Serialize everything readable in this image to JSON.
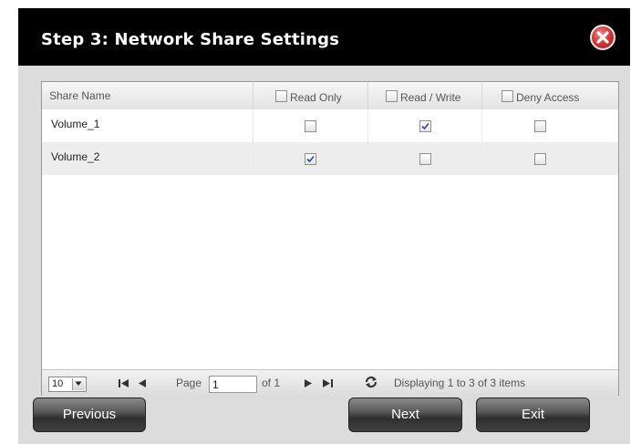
{
  "dialog": {
    "title": "Step 3: Network Share Settings",
    "close_icon": "close-icon"
  },
  "table": {
    "columns": [
      {
        "label": "Share Name"
      },
      {
        "label": "Read Only",
        "checked": false
      },
      {
        "label": "Read / Write",
        "checked": false
      },
      {
        "label": "Deny Access",
        "checked": false
      }
    ],
    "rows": [
      {
        "name": "Volume_1",
        "read_only": false,
        "read_write": true,
        "deny_access": false
      },
      {
        "name": "Volume_2",
        "read_only": true,
        "read_write": false,
        "deny_access": false
      }
    ]
  },
  "pager": {
    "page_size": "10",
    "page_label": "Page",
    "page_value": "1",
    "of_label": "of 1",
    "status": "Displaying 1 to 3 of 3 items"
  },
  "buttons": {
    "previous": "Previous",
    "next": "Next",
    "exit": "Exit"
  },
  "colors": {
    "titlebar": "#000000",
    "dialog_bg": "#dcdcdc",
    "close_button": "#d43a3a",
    "alt_row": "#ededed"
  }
}
